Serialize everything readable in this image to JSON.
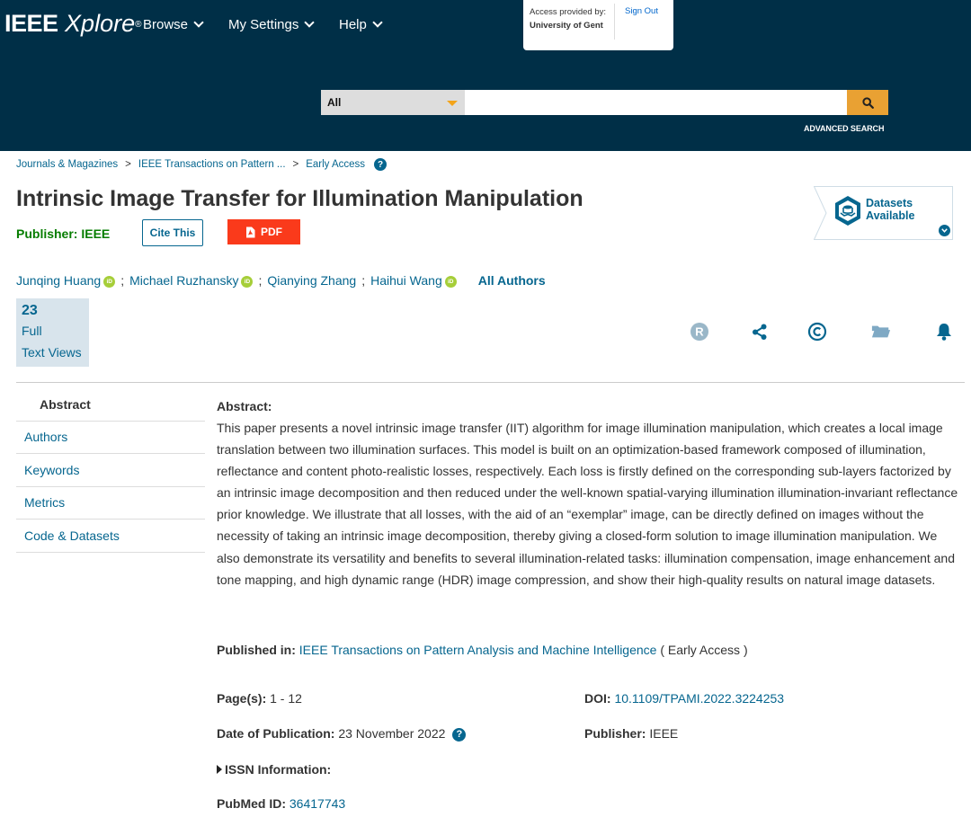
{
  "header": {
    "logo_bold": "IEEE",
    "logo_italic": "Xplore",
    "logo_reg": "®",
    "nav": [
      {
        "label": "Browse"
      },
      {
        "label": "My Settings"
      },
      {
        "label": "Help"
      }
    ],
    "access": {
      "provided_by": "Access provided by:",
      "institution": "University of Gent",
      "sign_out": "Sign Out"
    },
    "search": {
      "scope": "All",
      "query": "",
      "advanced": "ADVANCED SEARCH"
    }
  },
  "breadcrumb": [
    "Journals & Magazines",
    "IEEE Transactions on Pattern ...",
    "Early Access"
  ],
  "breadcrumb_sep": ">",
  "document": {
    "title": "Intrinsic Image Transfer for Illumination Manipulation",
    "publisher_label": "Publisher:  IEEE",
    "cite_label": "Cite This",
    "pdf_label": "PDF",
    "datasets_line1": "Datasets",
    "datasets_line2": "Available",
    "authors": [
      {
        "name": "Junqing Huang",
        "orcid": true
      },
      {
        "name": "Michael Ruzhansky",
        "orcid": true
      },
      {
        "name": "Qianying Zhang",
        "orcid": false
      },
      {
        "name": "Haihui Wang",
        "orcid": true
      }
    ],
    "all_authors": "All Authors",
    "metrics": {
      "count": "23",
      "label1": "Full",
      "label2": "Text Views"
    }
  },
  "sidebar": {
    "items": [
      {
        "label": "Abstract",
        "active": true
      },
      {
        "label": "Authors"
      },
      {
        "label": "Keywords"
      },
      {
        "label": "Metrics"
      },
      {
        "label": "Code & Datasets"
      }
    ]
  },
  "abstract": {
    "heading": "Abstract:",
    "text": "This paper presents a novel intrinsic image transfer (IIT) algorithm for image illumination manipulation, which creates a local image translation between two illumination surfaces. This model is built on an optimization-based framework composed of illumination, reflectance and content photo-realistic losses, respectively. Each loss is firstly defined on the corresponding sub-layers factorized by an intrinsic image decomposition and then reduced under the well-known spatial-varying illumination illumination-invariant reflectance prior knowledge. We illustrate that all losses, with the aid of an “exemplar” image, can be directly defined on images without the necessity of taking an intrinsic image decomposition, thereby giving a closed-form solution to image illumination manipulation. We also demonstrate its versatility and benefits to several illumination-related tasks: illumination compensation, image enhancement and tone mapping, and high dynamic range (HDR) image compression, and show their high-quality results on natural image datasets."
  },
  "details": {
    "published_in_label": "Published in:",
    "published_in_value": "IEEE Transactions on Pattern Analysis and Machine Intelligence",
    "published_in_suffix": "( Early Access )",
    "pages_label": "Page(s):",
    "pages_value": "1 - 12",
    "doi_label": "DOI:",
    "doi_value": "10.1109/TPAMI.2022.3224253",
    "date_label": "Date of Publication:",
    "date_value": "23 November 2022",
    "publisher_label": "Publisher:",
    "publisher_value": "IEEE",
    "issn_label": "ISSN Information:",
    "pubmed_label": "PubMed ID:",
    "pubmed_value": "36417743"
  },
  "icons": [
    "search-icon",
    "pdf-icon",
    "datasets-icon",
    "rights-icon",
    "share-icon",
    "copyright-icon",
    "folder-icon",
    "bell-icon"
  ],
  "colors": {
    "header_bg": "#002f47",
    "link": "#06668f",
    "publisher_green": "#067d00",
    "pdf_red": "#fa3a1b",
    "search_orange": "#e9a133",
    "orcid_green": "#a6ce39"
  }
}
